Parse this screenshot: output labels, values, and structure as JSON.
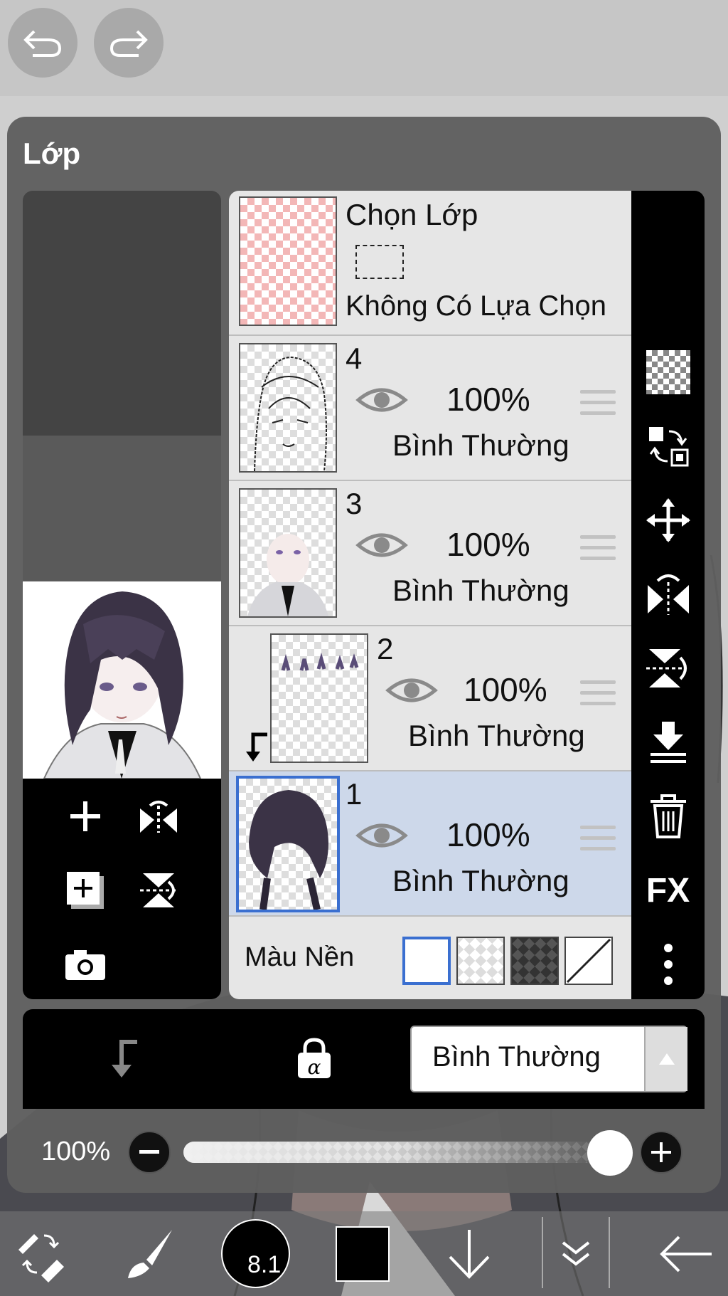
{
  "panel": {
    "title": "Lớp"
  },
  "selection_layer": {
    "title": "Chọn Lớp",
    "status": "Không Có Lựa Chọn"
  },
  "layers": [
    {
      "number": "4",
      "opacity": "100%",
      "blend": "Bình Thường",
      "selected": false,
      "clipped": false
    },
    {
      "number": "3",
      "opacity": "100%",
      "blend": "Bình Thường",
      "selected": false,
      "clipped": false
    },
    {
      "number": "2",
      "opacity": "100%",
      "blend": "Bình Thường",
      "selected": false,
      "clipped": true
    },
    {
      "number": "1",
      "opacity": "100%",
      "blend": "Bình Thường",
      "selected": true,
      "clipped": false
    }
  ],
  "background": {
    "label": "Màu Nền",
    "options": [
      "white",
      "transparent-light",
      "transparent-dark",
      "none"
    ],
    "selected": "white"
  },
  "right_tools": [
    "transparency-icon",
    "swap-layer-icon",
    "move-icon",
    "flip-horizontal-icon",
    "flip-vertical-icon",
    "merge-down-icon",
    "delete-icon",
    "fx-icon",
    "more-icon"
  ],
  "right_tools_text": {
    "fx": "FX"
  },
  "left_tools": [
    "add-layer-icon",
    "flip-layer-icon",
    "add-special-layer-icon",
    "rotate-layer-icon",
    "camera-icon"
  ],
  "blend_bar": {
    "mode": "Bình Thường"
  },
  "opacity_slider": {
    "label": "100%",
    "value": 1.0
  },
  "toolbar": {
    "brush_size": "8.1",
    "color": "#000000"
  },
  "colors": {
    "selected_layer": "#cdd8ea",
    "selection_border": "#3a6fd0",
    "panel": "#5f5f5f"
  }
}
